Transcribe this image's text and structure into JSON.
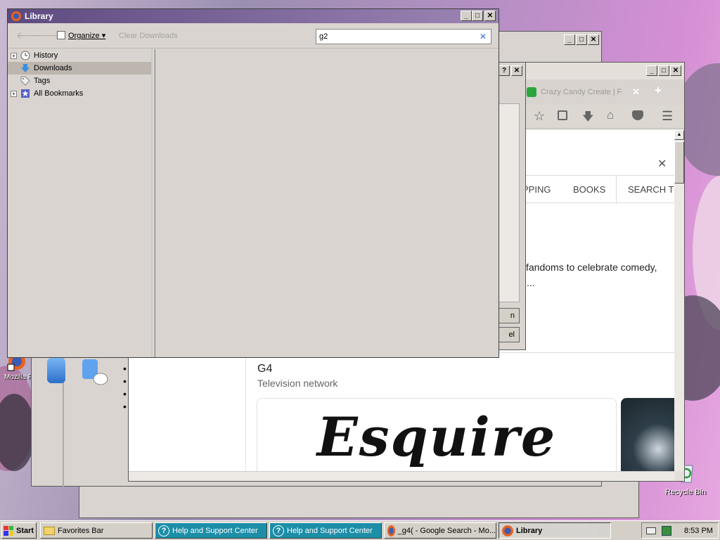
{
  "desktop": {
    "icons": [
      {
        "label": "Mozilla F"
      },
      {
        "label": "Recycle Bin"
      }
    ]
  },
  "library": {
    "title": "Library",
    "toolbar": {
      "back": "back",
      "forward": "forward",
      "organize": "Organize",
      "clear_downloads": "Clear Downloads"
    },
    "search": {
      "value": "g2"
    },
    "tree": [
      {
        "label": "History",
        "icon": "clock-icon",
        "expandable": true
      },
      {
        "label": "Downloads",
        "icon": "download-arrow-icon",
        "expandable": false,
        "selected": true
      },
      {
        "label": "Tags",
        "icon": "tag-icon",
        "expandable": false
      },
      {
        "label": "All Bookmarks",
        "icon": "star-icon",
        "expandable": true
      }
    ]
  },
  "browser": {
    "tab_title": "Crazy Candy Create | F",
    "search_tabs": [
      "PPING",
      "BOOKS",
      "SEARCH TO"
    ],
    "snippet_1": "l fandoms to celebrate comedy,",
    "snippet_2": "...",
    "result_title": "G4",
    "result_subtitle": "Television network",
    "logo_text": "Esquire"
  },
  "dialog": {
    "button1": "n",
    "button2": "el"
  },
  "taskbar": {
    "start": "Start",
    "buttons": [
      {
        "label": "Favorites Bar"
      },
      {
        "label": "Help and Support Center"
      },
      {
        "label": "Help and Support Center"
      },
      {
        "label": "_g4( - Google Search - Mo..."
      },
      {
        "label": "Library"
      }
    ],
    "clock": "8:53 PM"
  },
  "colors": {
    "titlebar": "#6a5590",
    "help_button": "#1c8ea8",
    "panel": "#d9d4cf"
  }
}
